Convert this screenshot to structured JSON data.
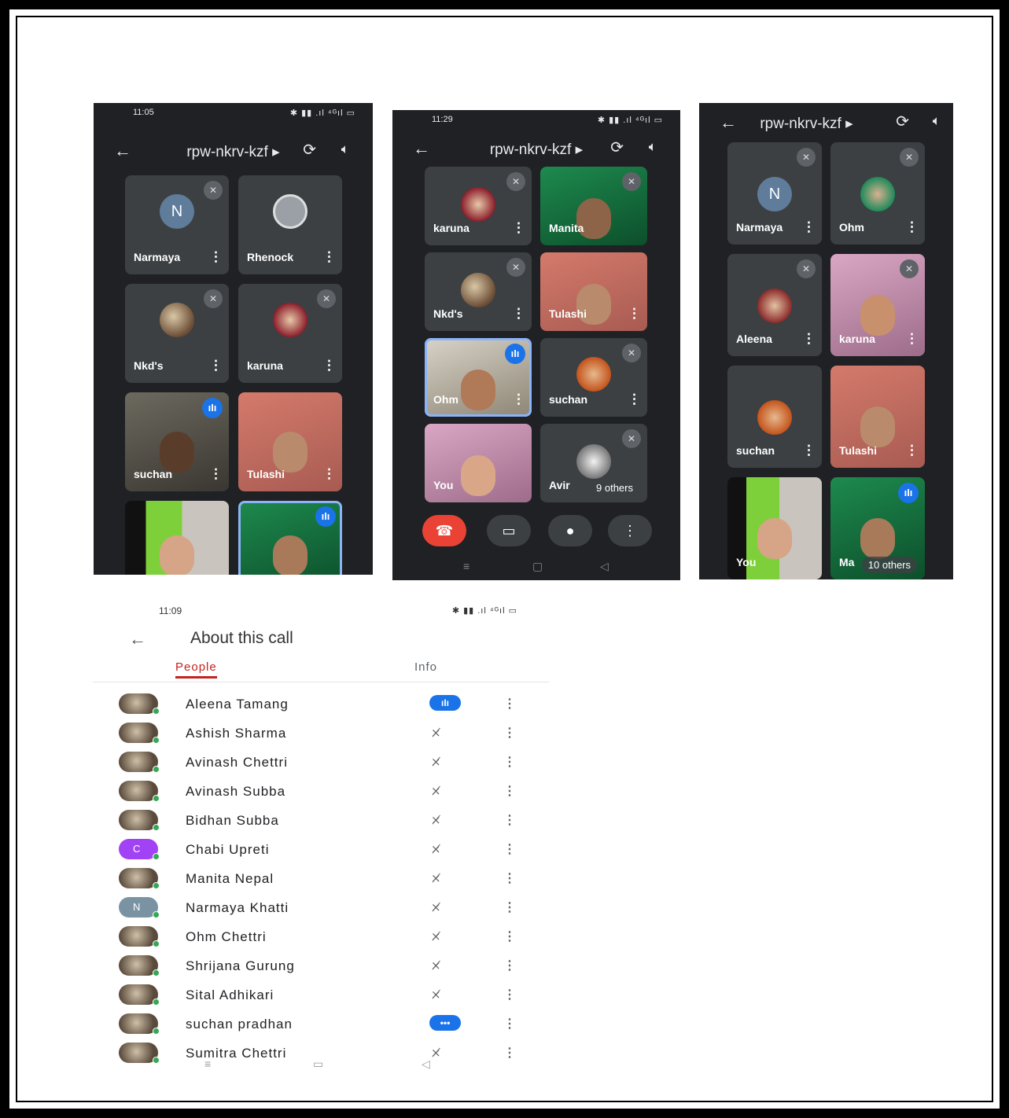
{
  "screens": [
    {
      "status_time": "11:05",
      "status_right": "✱ ▮▮ .ıl ⁴ᴳıl ▭",
      "meeting_code": "rpw-nkrv-kzf ▸",
      "tiles": [
        {
          "name": "Narmaya",
          "avatar": "N"
        },
        {
          "name": "Rhenock"
        },
        {
          "name": "Nkd's"
        },
        {
          "name": "karuna"
        },
        {
          "name": "suchan"
        },
        {
          "name": "Tulashi"
        },
        {
          "name": ""
        },
        {
          "name": ""
        }
      ]
    },
    {
      "status_time": "11:29",
      "status_right": "✱ ▮▮ .ıl ⁴ᴳıl ▭",
      "meeting_code": "rpw-nkrv-kzf ▸",
      "tiles": [
        {
          "name": "karuna"
        },
        {
          "name": "Manita"
        },
        {
          "name": "Nkd's"
        },
        {
          "name": "Tulashi"
        },
        {
          "name": "Ohm"
        },
        {
          "name": "suchan"
        },
        {
          "name": "You"
        },
        {
          "name": "Avir"
        }
      ],
      "others_label": "9 others"
    },
    {
      "meeting_code": "rpw-nkrv-kzf ▸",
      "tiles": [
        {
          "name": "Narmaya",
          "avatar": "N"
        },
        {
          "name": "Ohm"
        },
        {
          "name": "Aleena"
        },
        {
          "name": "karuna"
        },
        {
          "name": "suchan"
        },
        {
          "name": "Tulashi"
        },
        {
          "name": "You"
        },
        {
          "name": "Ma"
        }
      ],
      "others_label": "10 others"
    }
  ],
  "about": {
    "status_time": "11:09",
    "status_right": "✱ ▮▮ .ıl ⁴ᴳıl ▭",
    "title": "About this call",
    "tabs": [
      "People",
      "Info"
    ],
    "people": [
      {
        "name": "Aleena Tamang",
        "status": "talking"
      },
      {
        "name": "Ashish Sharma",
        "status": "muted"
      },
      {
        "name": "Avinash Chettri",
        "status": "muted"
      },
      {
        "name": "Avinash Subba",
        "status": "muted"
      },
      {
        "name": "Bidhan Subba",
        "status": "muted"
      },
      {
        "name": "Chabi Upreti",
        "status": "muted",
        "avatar": "C"
      },
      {
        "name": "Manita Nepal",
        "status": "muted"
      },
      {
        "name": "Narmaya Khatti",
        "status": "muted",
        "avatar": "N"
      },
      {
        "name": "Ohm Chettri",
        "status": "muted"
      },
      {
        "name": "Shrijana Gurung",
        "status": "muted"
      },
      {
        "name": "Sital Adhikari",
        "status": "muted"
      },
      {
        "name": "suchan pradhan",
        "status": "talking"
      },
      {
        "name": "Sumitra Chettri",
        "status": "muted"
      }
    ]
  },
  "colors": {
    "dark_bg": "#202124",
    "tile_bg": "#3c4043",
    "accent_blue": "#1a73e8",
    "end_red": "#ea4335",
    "tab_red": "#c5221f"
  }
}
